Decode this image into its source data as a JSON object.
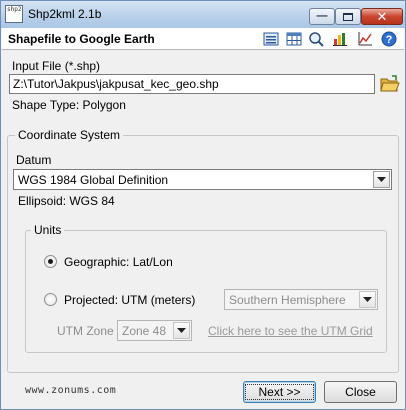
{
  "window": {
    "title": "Shp2kml 2.1b",
    "app_icon_text": "shp2"
  },
  "header": {
    "title": "Shapefile to Google Earth",
    "toolbar_icons": [
      "list-view-icon",
      "table-view-icon",
      "zoom-icon",
      "chart-icon",
      "graph-icon",
      "help-icon"
    ]
  },
  "input": {
    "label": "Input File (*.shp)",
    "path": "Z:\\Tutor\\Jakpus\\jakpusat_kec_geo.shp",
    "shape_type": "Shape Type: Polygon"
  },
  "coordinate_system": {
    "legend": "Coordinate System",
    "datum_label": "Datum",
    "datum_value": "WGS 1984 Global Definition",
    "ellipsoid": "Ellipsoid: WGS 84"
  },
  "units": {
    "legend": "Units",
    "geographic_label": "Geographic: Lat/Lon",
    "projected_label": "Projected: UTM (meters)",
    "hemisphere_value": "Southern Hemisphere",
    "utm_zone_label": "UTM Zone",
    "utm_zone_value": "Zone 48",
    "utm_grid_link": "Click here to see the UTM Grid",
    "selected": "geographic"
  },
  "footer": {
    "url": "www.zonums.com",
    "next_label": "Next >>",
    "close_label": "Close"
  },
  "colors": {
    "titlebar": "#b9d1ea",
    "close_button": "#c9462f",
    "default_button_border": "#3c7fb1"
  }
}
